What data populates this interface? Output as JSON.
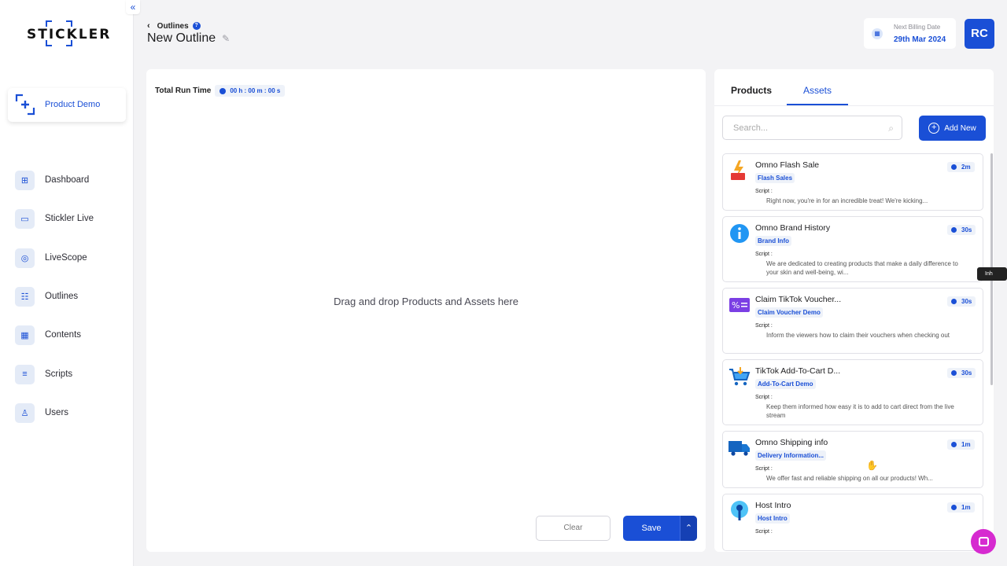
{
  "brand": {
    "logo_text": "STICKLER"
  },
  "sidebar": {
    "collapse_label": "«",
    "product": {
      "label": "Product Demo"
    },
    "items": [
      {
        "label": "Dashboard",
        "icon": "dashboard-icon"
      },
      {
        "label": "Stickler Live",
        "icon": "video-icon"
      },
      {
        "label": "LiveScope",
        "icon": "scope-icon"
      },
      {
        "label": "Outlines",
        "icon": "outline-icon"
      },
      {
        "label": "Contents",
        "icon": "contents-icon"
      },
      {
        "label": "Scripts",
        "icon": "script-icon"
      },
      {
        "label": "Users",
        "icon": "user-icon"
      }
    ]
  },
  "header": {
    "breadcrumb": "Outlines",
    "title": "New Outline",
    "billing_label": "Next Billing Date",
    "billing_date": "29th Mar 2024",
    "avatar_initials": "RC"
  },
  "main": {
    "runtime_label": "Total Run Time",
    "runtime_value": "00 h : 00 m : 00 s",
    "drop_hint": "Drag and drop Products and Assets here",
    "clear_label": "Clear",
    "save_label": "Save"
  },
  "panel": {
    "tabs": [
      {
        "label": "Products"
      },
      {
        "label": "Assets"
      }
    ],
    "active_tab": "Assets",
    "search_placeholder": "Search...",
    "add_label": "Add New",
    "script_label": "Script :",
    "assets": [
      {
        "title": "Omno Flash Sale",
        "tag": "Flash Sales",
        "duration": "2m",
        "script": "Right now, you're in for an incredible treat! We're kicking...",
        "icon": "flash-sale-icon"
      },
      {
        "title": "Omno Brand History",
        "tag": "Brand Info",
        "duration": "30s",
        "script": "We are dedicated to creating products that make a daily difference to your skin and well-being, wi...",
        "icon": "info-icon"
      },
      {
        "title": "Claim TikTok Voucher...",
        "tag": "Claim Voucher Demo",
        "duration": "30s",
        "script": "Inform the viewers how to claim their vouchers when checking out",
        "icon": "voucher-icon"
      },
      {
        "title": "TikTok Add-To-Cart D...",
        "tag": "Add-To-Cart Demo",
        "duration": "30s",
        "script": "Keep them informed how easy it is to add to cart direct from the live stream",
        "icon": "cart-icon"
      },
      {
        "title": "Omno Shipping info",
        "tag": "Delivery Information...",
        "duration": "1m",
        "script": "We offer fast and reliable shipping on all our products! Wh...",
        "icon": "truck-icon"
      },
      {
        "title": "Host Intro",
        "tag": "Host Intro",
        "duration": "1m",
        "script": "",
        "icon": "host-icon"
      }
    ]
  },
  "tooltip": "Inh",
  "colors": {
    "accent": "#1a4fd6",
    "chat": "#d62ad0"
  }
}
